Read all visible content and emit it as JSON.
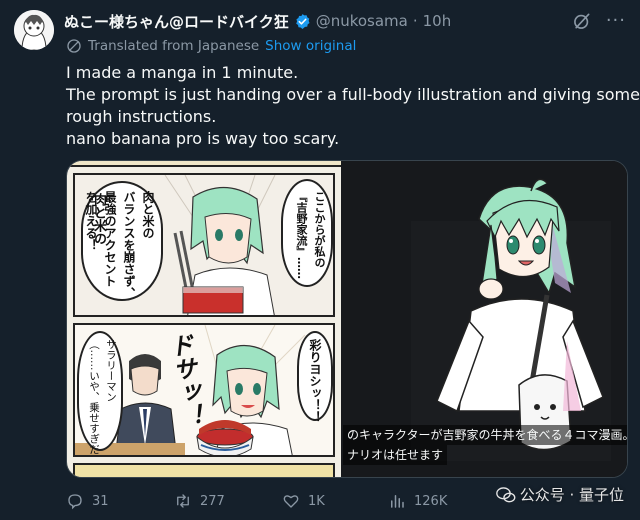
{
  "post": {
    "display_name": "ぬこー様ちゃん@ロードバイク狂",
    "handle": "@nukosama",
    "separator": "·",
    "time": "10h",
    "translated_label": "Translated from Japanese",
    "show_original": "Show original",
    "text_lines": [
      "I made a manga in 1 minute.",
      "The prompt is just handing over a full-body illustration and giving some",
      "rough instructions.",
      "nano banana pro is way too scary."
    ]
  },
  "manga": {
    "panel1_bubble_a": "ここからが私の",
    "panel1_bubble_a2": "『吉野家流』……",
    "panel1_bubble_b1": "肉と米の",
    "panel1_bubble_b2": "バランスを崩さず、",
    "panel1_bubble_b3": "最強のアクセント",
    "panel1_bubble_b4": "を加える！",
    "panel2_sfx": "ドサッ！",
    "panel2_bubble_right": "彩りヨシッ！！",
    "panel2_bubble_left1": "サラリーマン",
    "panel2_bubble_left2": "（……いや、乗せすぎだろ）"
  },
  "media_caption": {
    "line1": "のキャラクターが吉野家の牛丼を食べる４コマ漫画。",
    "line2": "ナリオは任せます"
  },
  "actions": {
    "replies": "31",
    "reposts": "277",
    "likes": "1K",
    "views": "126K"
  },
  "watermark": {
    "text": "公众号 · 量子位"
  },
  "colors": {
    "background": "#15202b",
    "accent": "#1d9bf0",
    "muted": "#8b98a5",
    "text": "#f7f9f9"
  }
}
